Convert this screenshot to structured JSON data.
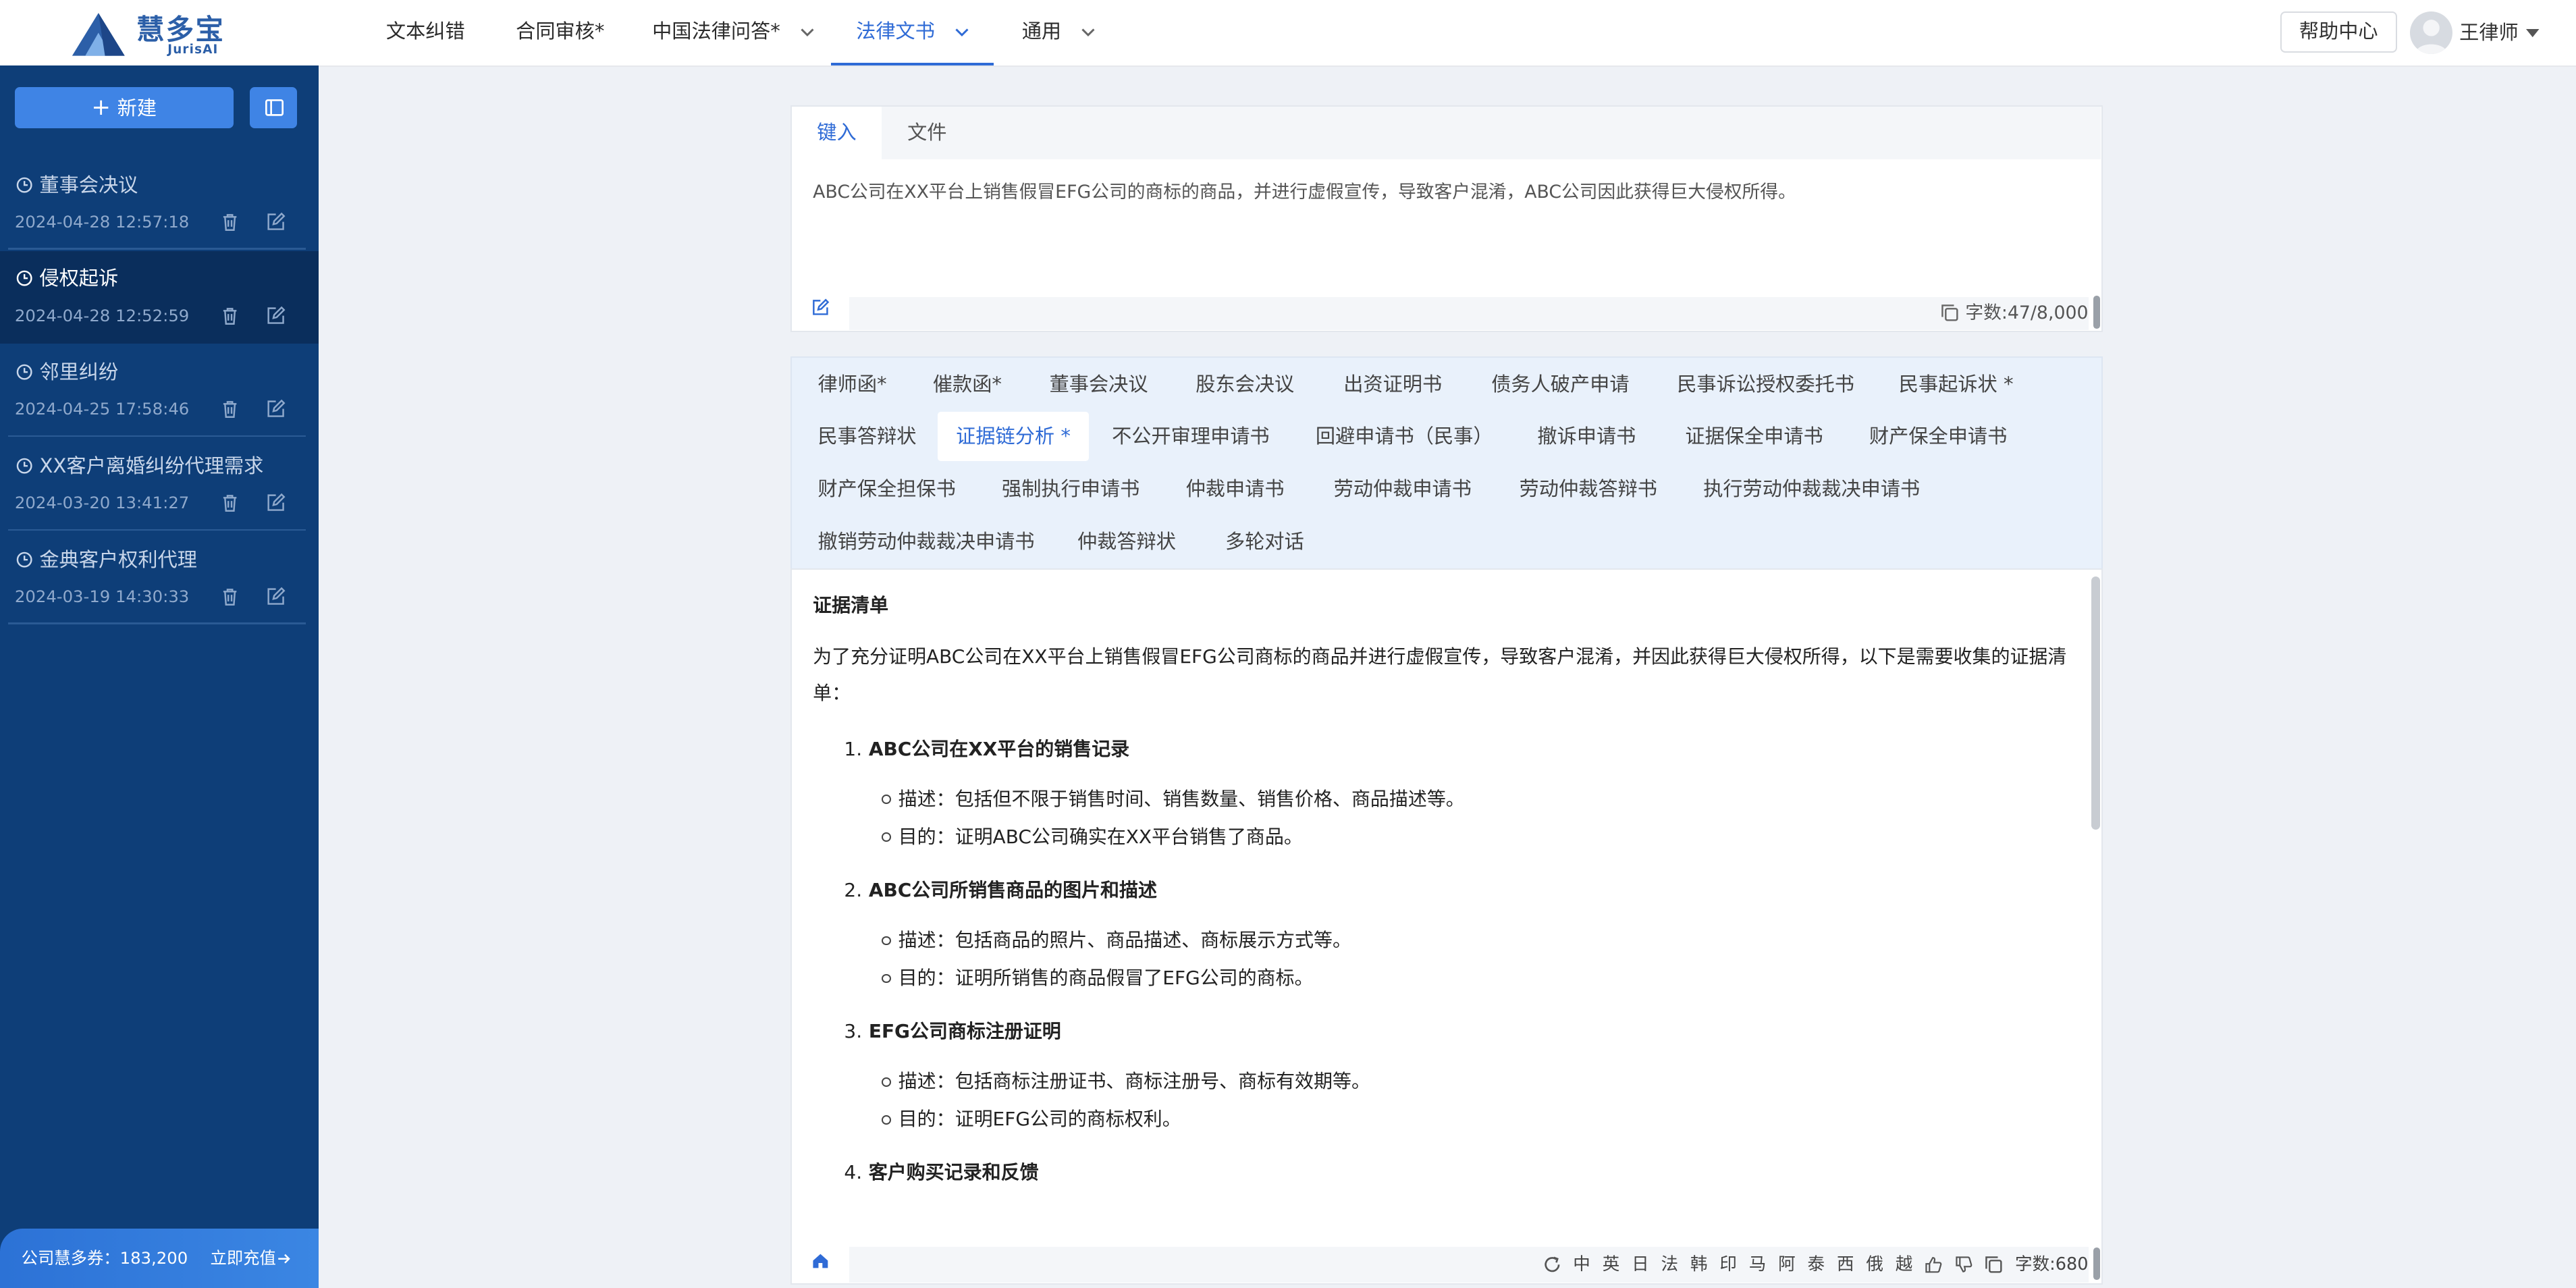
{
  "brand": {
    "name": "慧多宝",
    "sub": "JurisAI"
  },
  "nav": {
    "items": [
      {
        "label": "文本纠错"
      },
      {
        "label": "合同审核*"
      },
      {
        "label": "中国法律问答*"
      },
      {
        "label": "法律文书"
      },
      {
        "label": "通用"
      }
    ],
    "active_index": 3,
    "help_label": "帮助中心",
    "user_name": "王律师"
  },
  "sidebar": {
    "new_label": "新建",
    "history": [
      {
        "title": "董事会决议",
        "date": "2024-04-28 12:57:18"
      },
      {
        "title": "侵权起诉",
        "date": "2024-04-28 12:52:59",
        "active": true
      },
      {
        "title": "邻里纠纷",
        "date": "2024-04-25 17:58:46"
      },
      {
        "title": "XX客户离婚纠纷代理需求",
        "date": "2024-03-20 13:41:27"
      },
      {
        "title": "金典客户权利代理",
        "date": "2024-03-19 14:30:33"
      }
    ],
    "credits_label": "公司慧多券：183,200",
    "recharge_label": "立即充值"
  },
  "input_card": {
    "tabs": [
      {
        "label": "键入"
      },
      {
        "label": "文件"
      }
    ],
    "active_tab": 0,
    "text": "ABC公司在XX平台上销售假冒EFG公司的商标的商品，并进行虚假宣传，导致客户混淆，ABC公司因此获得巨大侵权所得。",
    "char_count": "字数:47/8,000"
  },
  "templates": {
    "rows": [
      [
        "律师函*",
        "催款函*",
        "董事会决议",
        "股东会决议",
        "出资证明书",
        "债务人破产申请",
        "民事诉讼授权委托书",
        "民事起诉状 *"
      ],
      [
        "民事答辩状",
        "证据链分析 *",
        "不公开审理申请书",
        "回避申请书（民事）",
        "撤诉申请书",
        "证据保全申请书",
        "财产保全申请书"
      ],
      [
        "财产保全担保书",
        "强制执行申请书",
        "仲裁申请书",
        "劳动仲裁申请书",
        "劳动仲裁答辩书",
        "执行劳动仲裁裁决申请书"
      ],
      [
        "撤销劳动仲裁裁决申请书",
        "仲裁答辩状",
        "多轮对话"
      ]
    ],
    "active": "证据链分析 *"
  },
  "output": {
    "title": "证据清单",
    "intro": "为了充分证明ABC公司在XX平台上销售假冒EFG公司商标的商品并进行虚假宣传，导致客户混淆，并因此获得巨大侵权所得，以下是需要收集的证据清单：",
    "sections": [
      {
        "num": "1.",
        "heading": "ABC公司在XX平台的销售记录",
        "bullets": [
          "描述：包括但不限于销售时间、销售数量、销售价格、商品描述等。",
          "目的：证明ABC公司确实在XX平台销售了商品。"
        ]
      },
      {
        "num": "2.",
        "heading": "ABC公司所销售商品的图片和描述",
        "bullets": [
          "描述：包括商品的照片、商品描述、商标展示方式等。",
          "目的：证明所销售的商品假冒了EFG公司的商标。"
        ]
      },
      {
        "num": "3.",
        "heading": "EFG公司商标注册证明",
        "bullets": [
          "描述：包括商标注册证书、商标注册号、商标有效期等。",
          "目的：证明EFG公司的商标权利。"
        ]
      },
      {
        "num": "4.",
        "heading": "客户购买记录和反馈",
        "bullets": []
      }
    ],
    "languages": [
      "中",
      "英",
      "日",
      "法",
      "韩",
      "印",
      "马",
      "阿",
      "泰",
      "西",
      "俄",
      "越"
    ],
    "char_count": "字数:680"
  },
  "colors": {
    "sidebar": "#0e3e78",
    "accent": "#2f6bd6",
    "button": "#3f84e5"
  }
}
